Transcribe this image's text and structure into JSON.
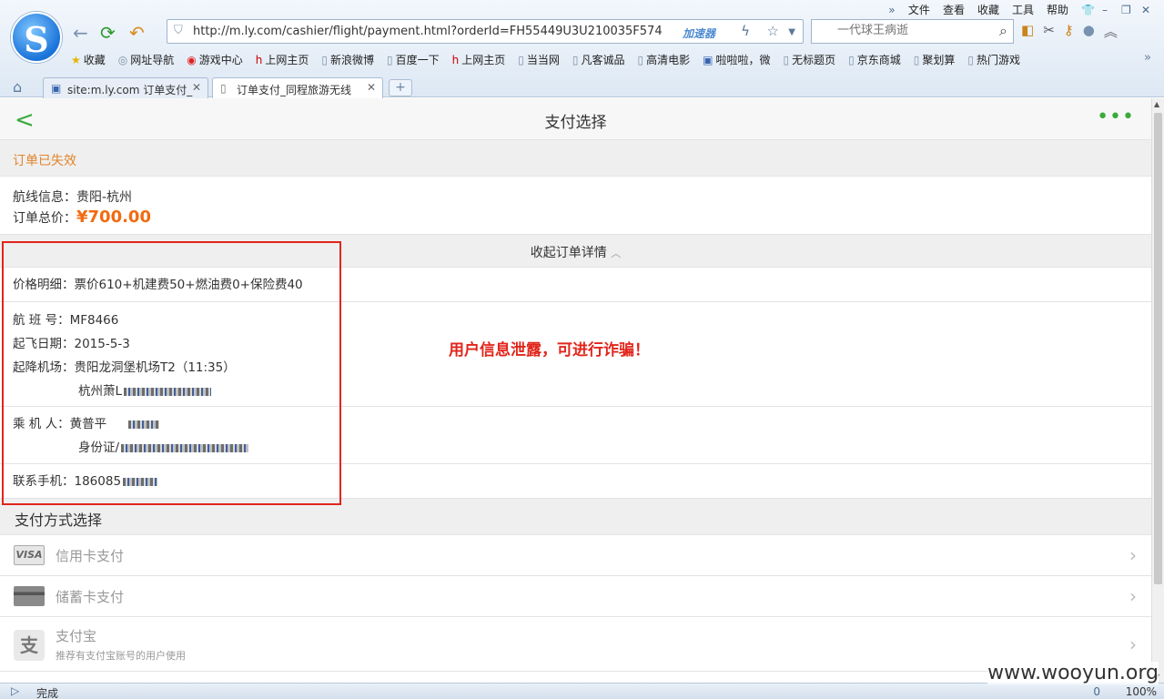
{
  "browser": {
    "menu": [
      "文件",
      "查看",
      "收藏",
      "工具",
      "帮助"
    ],
    "url": "http://m.ly.com/cashier/flight/payment.html?orderId=FH55449U3U210035F574",
    "accelerator": "加速器",
    "search_placeholder": "一代球王病逝",
    "bookmarks": [
      "收藏",
      "网址导航",
      "游戏中心",
      "上网主页",
      "新浪微博",
      "百度一下",
      "上网主页",
      "当当网",
      "凡客诚品",
      "高清电影",
      "啦啦啦，微",
      "无标题页",
      "京东商城",
      "聚划算",
      "热门游戏"
    ],
    "tabs": [
      {
        "label": "site:m.ly.com 订单支付_"
      },
      {
        "label": "订单支付_同程旅游无线"
      }
    ],
    "status": "完成",
    "download_count": "0",
    "zoom": "100%"
  },
  "page": {
    "title": "支付选择",
    "order_status": "订单已失效",
    "route_label": "航线信息：",
    "route": "贵阳-杭州",
    "total_label": "订单总价：",
    "total": "¥700.00",
    "collapse_label": "收起订单详情",
    "price_detail_label": "价格明细：",
    "price_detail": "票价610+机建费50+燃油费0+保险费40",
    "flight_no_label": "航 班 号：",
    "flight_no": "MF8466",
    "date_label": "起飞日期：",
    "date": "2015-5-3",
    "airports_label": "起降机场：",
    "dep_airport": "贵阳龙洞堡机场T2（11:35）",
    "arr_airport": "杭州萧L",
    "passenger_label": "乘 机 人：",
    "passenger": "黄普平",
    "id_label": "身份证/",
    "phone_label": "联系手机：",
    "phone": "186085",
    "warning": "用户信息泄露，可进行诈骗！",
    "pay_section": "支付方式选择",
    "pay_methods": [
      {
        "label": "信用卡支付",
        "icon": "visa-card-icon"
      },
      {
        "label": "储蓄卡支付",
        "icon": "debit-card-icon"
      },
      {
        "label": "支付宝",
        "sub": "推荐有支付宝账号的用户使用",
        "icon": "alipay-icon"
      }
    ],
    "visa_text": "VISA",
    "watermark": "www.wooyun.org"
  }
}
